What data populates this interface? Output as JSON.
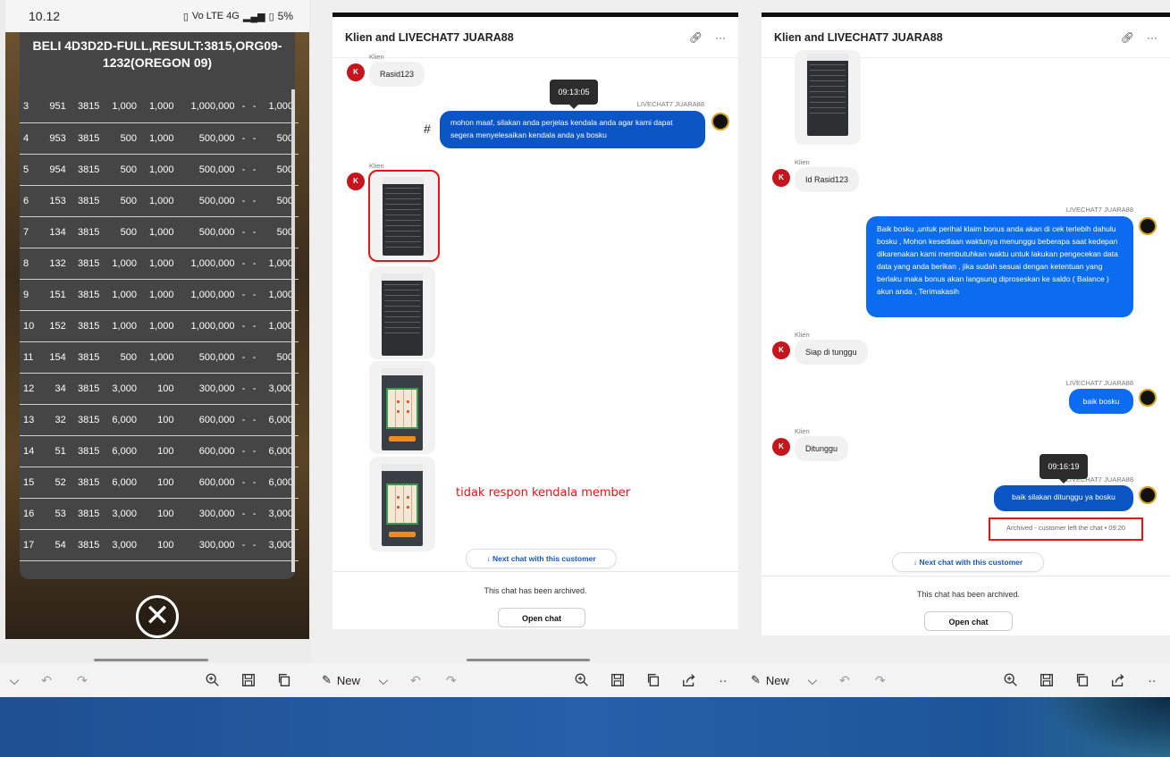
{
  "phone": {
    "time": "10.12",
    "status_icons": "Vo LTE 4G",
    "battery": "5%",
    "title": "BELI 4D3D2D-FULL,RESULT:3815,ORG09-1232(OREGON 09)",
    "rows": [
      [
        "3",
        "951",
        "3815",
        "1,000",
        "1,000",
        "1,000,000",
        "-",
        "-",
        "1,000"
      ],
      [
        "4",
        "953",
        "3815",
        "500",
        "1,000",
        "500,000",
        "-",
        "-",
        "500"
      ],
      [
        "5",
        "954",
        "3815",
        "500",
        "1,000",
        "500,000",
        "-",
        "-",
        "500"
      ],
      [
        "6",
        "153",
        "3815",
        "500",
        "1,000",
        "500,000",
        "-",
        "-",
        "500"
      ],
      [
        "7",
        "134",
        "3815",
        "500",
        "1,000",
        "500,000",
        "-",
        "-",
        "500"
      ],
      [
        "8",
        "132",
        "3815",
        "1,000",
        "1,000",
        "1,000,000",
        "-",
        "-",
        "1,000"
      ],
      [
        "9",
        "151",
        "3815",
        "1,000",
        "1,000",
        "1,000,000",
        "-",
        "-",
        "1,000"
      ],
      [
        "10",
        "152",
        "3815",
        "1,000",
        "1,000",
        "1,000,000",
        "-",
        "-",
        "1,000"
      ],
      [
        "11",
        "154",
        "3815",
        "500",
        "1,000",
        "500,000",
        "-",
        "-",
        "500"
      ],
      [
        "12",
        "34",
        "3815",
        "3,000",
        "100",
        "300,000",
        "-",
        "-",
        "3,000"
      ],
      [
        "13",
        "32",
        "3815",
        "6,000",
        "100",
        "600,000",
        "-",
        "-",
        "6,000"
      ],
      [
        "14",
        "51",
        "3815",
        "6,000",
        "100",
        "600,000",
        "-",
        "-",
        "6,000"
      ],
      [
        "15",
        "52",
        "3815",
        "6,000",
        "100",
        "600,000",
        "-",
        "-",
        "6,000"
      ],
      [
        "16",
        "53",
        "3815",
        "3,000",
        "100",
        "300,000",
        "-",
        "-",
        "3,000"
      ],
      [
        "17",
        "54",
        "3815",
        "3,000",
        "100",
        "300,000",
        "-",
        "-",
        "3,000"
      ]
    ]
  },
  "toolbar": {
    "new_label": "New"
  },
  "chat_left": {
    "title": "Klien and LIVECHAT7 JUARA88",
    "client_label": "Klien",
    "avatar_letter": "K",
    "msg_client_1": "Rasid123",
    "tooltip_time": "09:13:05",
    "agent_label": "LIVECHAT7 JUARA88",
    "hash_mark": "#",
    "msg_agent_1": "mohon maaf, silakan anda perjelas kendala anda agar kami dapat segera menyelesaikan kendala anda ya bosku",
    "annotation": "tidak respon kendala member",
    "next_chat": "Next chat with this customer",
    "archived": "This chat has been archived.",
    "open_chat": "Open chat"
  },
  "chat_right": {
    "title": "Klien and LIVECHAT7 JUARA88",
    "client_label": "Klien",
    "avatar_letter": "K",
    "agent_label": "LIVECHAT7 JUARA88",
    "msg_client_1": "Id Rasid123",
    "msg_agent_1": "Baik bosku ,untuk perihal klaim bonus anda akan di cek terlebih dahulu bosku , Mohon kesediaan waktunya menunggu beberapa saat kedepan dikarenakan kami membutuhkan waktu untuk lakukan pengecekan data data yang anda berikan , jika sudah sesuai dengan ketentuan yang berlaku maka bonus akan langsung diproseskan ke saldo ( Balance ) akun anda , Terimakasih",
    "msg_client_2": "Siap di tunggu",
    "msg_agent_2": "baik bosku",
    "msg_client_3": "Ditunggu",
    "tooltip_time": "09:16:19",
    "msg_agent_3": "baik silakan ditunggu ya bosku",
    "archived_note": "Archived - customer left the chat • 09:20",
    "next_chat": "Next chat with this customer",
    "archived": "This chat has been archived.",
    "open_chat": "Open chat"
  }
}
